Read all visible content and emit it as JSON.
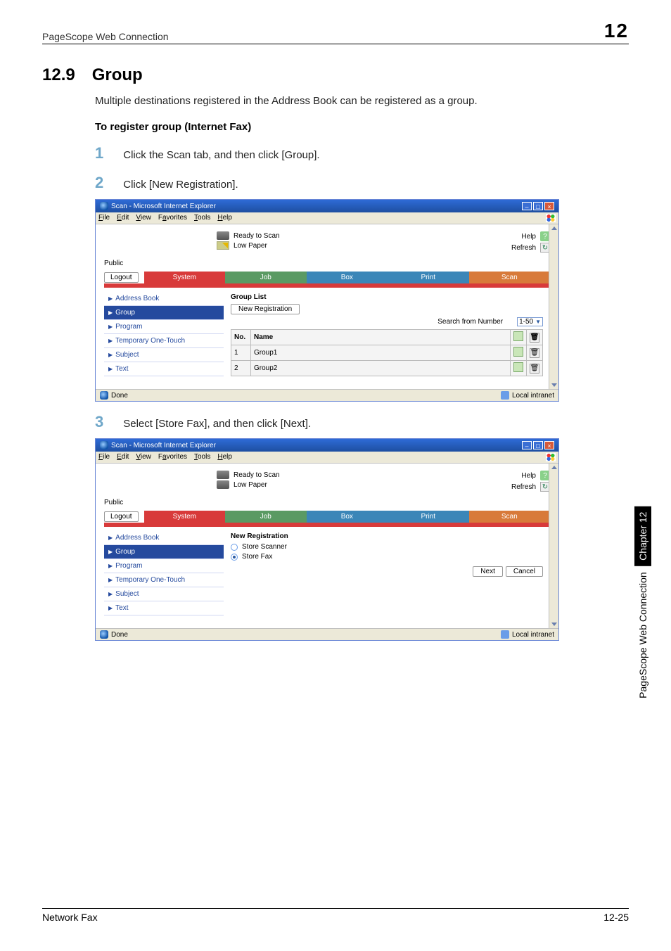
{
  "page_header": {
    "title": "PageScope Web Connection",
    "number": "12"
  },
  "side_tab": {
    "black": "Chapter 12",
    "white": "PageScope Web Connection"
  },
  "section": {
    "number": "12.9",
    "title": "Group"
  },
  "intro": "Multiple destinations registered in the Address Book can be registered as a group.",
  "sub_heading": "To register group (Internet Fax)",
  "steps": {
    "s1": {
      "n": "1",
      "text": "Click the Scan tab, and then click [Group]."
    },
    "s2": {
      "n": "2",
      "text": "Click [New Registration]."
    },
    "s3": {
      "n": "3",
      "text": "Select [Store Fax], and then click [Next]."
    }
  },
  "ie": {
    "title": "Scan - Microsoft Internet Explorer",
    "menu": {
      "file": "File",
      "edit": "Edit",
      "view": "View",
      "fav": "Favorites",
      "tools": "Tools",
      "help": "Help"
    },
    "status": {
      "ready": "Ready to Scan",
      "lowpaper": "Low Paper"
    },
    "help": "Help",
    "refresh": "Refresh",
    "public": "Public",
    "logout": "Logout",
    "tabs": {
      "system": "System",
      "job": "Job",
      "box": "Box",
      "print": "Print",
      "scan": "Scan"
    },
    "sidebar": {
      "addrbook": "Address Book",
      "group": "Group",
      "program": "Program",
      "tempone": "Temporary One-Touch",
      "subject": "Subject",
      "text": "Text"
    },
    "content1": {
      "title": "Group List",
      "newreg": "New Registration",
      "searchfrom": "Search from Number",
      "range": "1-50",
      "col_no": "No.",
      "col_name": "Name",
      "rows": [
        {
          "no": "1",
          "name": "Group1"
        },
        {
          "no": "2",
          "name": "Group2"
        }
      ]
    },
    "content2": {
      "title": "New Registration",
      "opt1": "Store Scanner",
      "opt2": "Store Fax",
      "next": "Next",
      "cancel": "Cancel"
    },
    "statusbar": {
      "done": "Done",
      "intranet": "Local intranet"
    }
  },
  "footer": {
    "left": "Network Fax",
    "right": "12-25"
  }
}
